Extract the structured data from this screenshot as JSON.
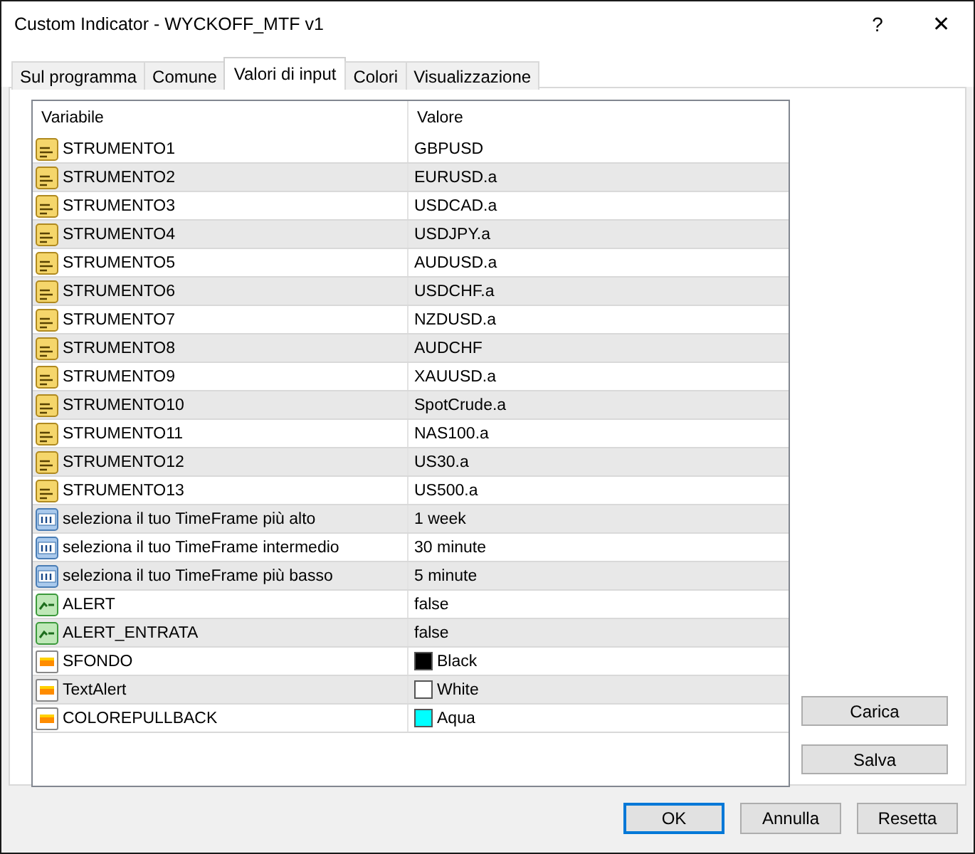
{
  "window": {
    "title": "Custom Indicator - WYCKOFF_MTF v1",
    "help": "?",
    "close": "✕"
  },
  "tabs": [
    {
      "label": "Sul programma",
      "selected": false
    },
    {
      "label": "Comune",
      "selected": false
    },
    {
      "label": "Valori di input",
      "selected": true
    },
    {
      "label": "Colori",
      "selected": false
    },
    {
      "label": "Visualizzazione",
      "selected": false
    }
  ],
  "table": {
    "columns": [
      "Variabile",
      "Valore"
    ],
    "rows": [
      {
        "kind": "string",
        "name": "STRUMENTO1",
        "value": "GBPUSD"
      },
      {
        "kind": "string",
        "name": "STRUMENTO2",
        "value": "EURUSD.a"
      },
      {
        "kind": "string",
        "name": "STRUMENTO3",
        "value": "USDCAD.a"
      },
      {
        "kind": "string",
        "name": "STRUMENTO4",
        "value": "USDJPY.a"
      },
      {
        "kind": "string",
        "name": "STRUMENTO5",
        "value": "AUDUSD.a"
      },
      {
        "kind": "string",
        "name": "STRUMENTO6",
        "value": "USDCHF.a"
      },
      {
        "kind": "string",
        "name": "STRUMENTO7",
        "value": "NZDUSD.a"
      },
      {
        "kind": "string",
        "name": "STRUMENTO8",
        "value": "AUDCHF"
      },
      {
        "kind": "string",
        "name": "STRUMENTO9",
        "value": "XAUUSD.a"
      },
      {
        "kind": "string",
        "name": "STRUMENTO10",
        "value": "SpotCrude.a"
      },
      {
        "kind": "string",
        "name": "STRUMENTO11",
        "value": "NAS100.a"
      },
      {
        "kind": "string",
        "name": "STRUMENTO12",
        "value": "US30.a"
      },
      {
        "kind": "string",
        "name": "STRUMENTO13",
        "value": "US500.a"
      },
      {
        "kind": "number",
        "name": "seleziona il tuo TimeFrame più alto",
        "value": "1 week"
      },
      {
        "kind": "number",
        "name": "seleziona il tuo TimeFrame intermedio",
        "value": "30 minute"
      },
      {
        "kind": "number",
        "name": "seleziona il tuo TimeFrame più basso",
        "value": "5 minute"
      },
      {
        "kind": "bool",
        "name": "ALERT",
        "value": "false"
      },
      {
        "kind": "bool",
        "name": "ALERT_ENTRATA",
        "value": "false"
      },
      {
        "kind": "color",
        "name": "SFONDO",
        "value": "Black",
        "color": "#000000"
      },
      {
        "kind": "color",
        "name": "TextAlert",
        "value": "White",
        "color": "#ffffff"
      },
      {
        "kind": "color",
        "name": "COLOREPULLBACK",
        "value": "Aqua",
        "color": "#00ffff"
      }
    ]
  },
  "side_buttons": [
    "Carica",
    "Salva"
  ],
  "buttons": [
    {
      "label": "OK",
      "default": true
    },
    {
      "label": "Annulla",
      "default": false
    },
    {
      "label": "Resetta",
      "default": false
    }
  ]
}
